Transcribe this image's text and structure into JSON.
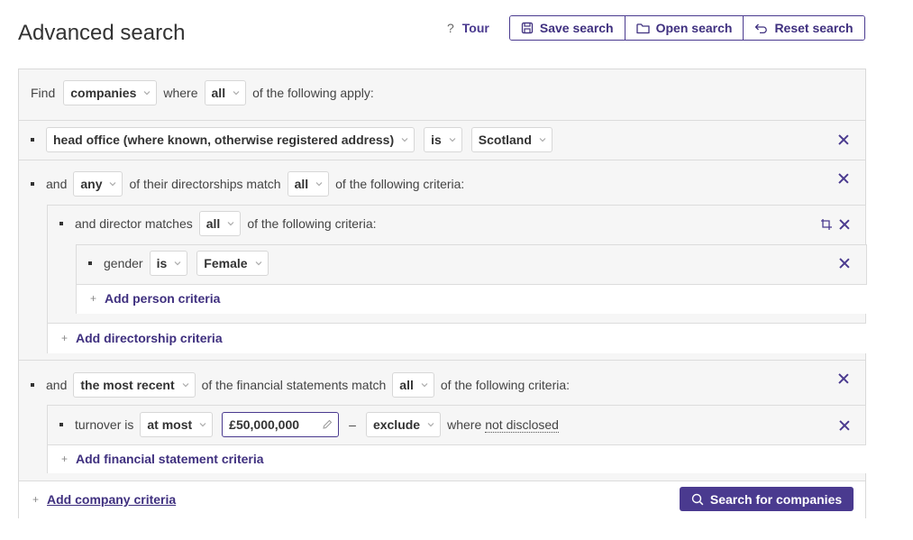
{
  "page": {
    "title": "Advanced search"
  },
  "toolbar": {
    "tour_label": "Tour",
    "save_label": "Save search",
    "open_label": "Open search",
    "reset_label": "Reset search"
  },
  "query": {
    "find_word": "Find",
    "entity": "companies",
    "where_word": "where",
    "match_mode": "all",
    "apply_text": "of the following apply:"
  },
  "criteria": {
    "head_office": {
      "field": "head office (where known, otherwise registered address)",
      "operator": "is",
      "value": "Scotland"
    },
    "directorships": {
      "and_word": "and",
      "quantifier": "any",
      "text": "of their directorships match",
      "mode": "all",
      "tail": "of the following criteria:",
      "director": {
        "text": "and director matches",
        "mode": "all",
        "tail": "of the following criteria:",
        "gender": {
          "field": "gender",
          "operator": "is",
          "value": "Female"
        },
        "add_person": "Add person criteria"
      },
      "add_directorship": "Add directorship criteria"
    },
    "financials": {
      "and_word": "and",
      "which": "the most recent",
      "text": "of the financial statements match",
      "mode": "all",
      "tail": "of the following criteria:",
      "turnover": {
        "field": "turnover is",
        "operator": "at most",
        "amount": "£50,000,000",
        "dash": "–",
        "disclosure": "exclude",
        "where_text": "where",
        "not_disclosed": "not disclosed"
      },
      "add_financial": "Add financial statement criteria"
    }
  },
  "footer": {
    "add_company": "Add company criteria",
    "search_button": "Search for companies"
  },
  "colors": {
    "accent": "#4a3a8f",
    "panel_bg": "#f6f6f6",
    "border": "#dcdcdc"
  }
}
